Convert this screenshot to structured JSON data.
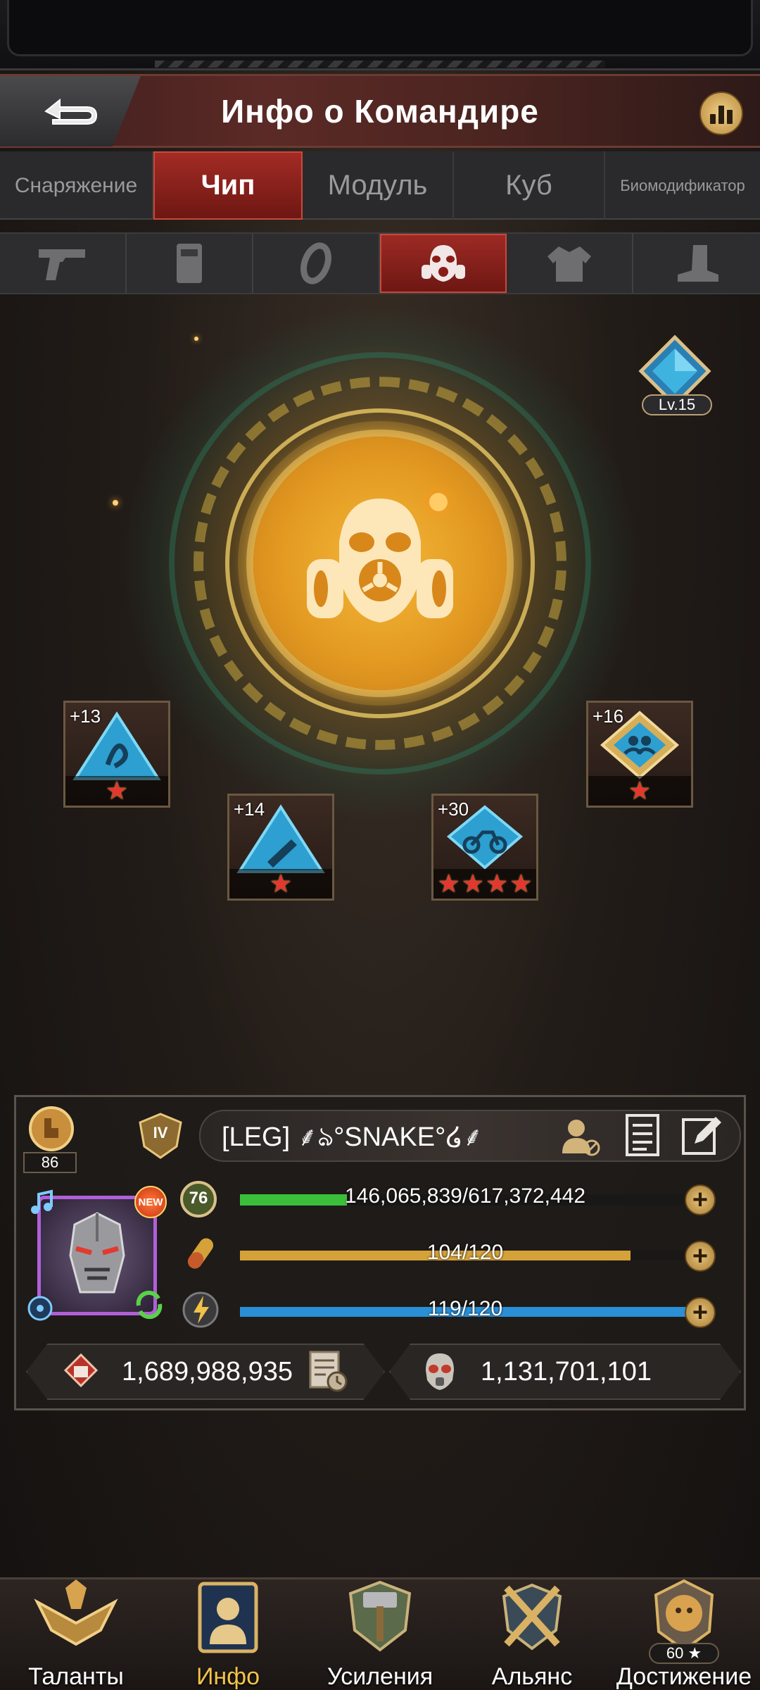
{
  "header": {
    "title": "Инфо о Командире"
  },
  "tabs": [
    {
      "label": "Снаряжение",
      "active": false
    },
    {
      "label": "Чип",
      "active": true
    },
    {
      "label": "Модуль",
      "active": false
    },
    {
      "label": "Куб",
      "active": false
    },
    {
      "label": "Биомодификатор",
      "active": false
    }
  ],
  "slots": [
    {
      "icon": "pistol-icon",
      "active": false
    },
    {
      "icon": "armor-plate-icon",
      "active": false
    },
    {
      "icon": "ring-icon",
      "active": false
    },
    {
      "icon": "gas-mask-icon",
      "active": true
    },
    {
      "icon": "jacket-icon",
      "active": false
    },
    {
      "icon": "boot-icon",
      "active": false
    }
  ],
  "chip_level": "Lv.15",
  "chips": [
    {
      "plus": "+13",
      "stars": 1,
      "icon": "triangle-chip-icon"
    },
    {
      "plus": "+14",
      "stars": 1,
      "icon": "triangle-chip-icon"
    },
    {
      "plus": "+30",
      "stars": 4,
      "icon": "motorbike-chip-icon"
    },
    {
      "plus": "+16",
      "stars": 1,
      "icon": "diamond-chip-icon"
    }
  ],
  "commander": {
    "rank_number": "86",
    "vip_level": "IV",
    "name": "[LEG] ⸙ঌ°SNAKE°໒⸙",
    "level": "76",
    "exp": "146,065,839/617,372,442",
    "exp_fraction": 0.237,
    "stamina": "104/120",
    "stamina_fraction": 0.867,
    "energy": "119/120",
    "energy_fraction": 0.992,
    "power": "1,689,988,935",
    "kills": "1,131,701,101",
    "avatar_badge": "NEW"
  },
  "colors": {
    "exp_bar": "#3bbf3b",
    "stamina_bar": "#d5a23a",
    "energy_bar": "#2a8fd6",
    "active_tab": "#a32b25",
    "nav_active": "#f3c24b"
  },
  "nav": [
    {
      "label": "Таланты",
      "icon": "eagle-emblem-icon"
    },
    {
      "label": "Инфо",
      "icon": "commander-info-icon",
      "active": true
    },
    {
      "label": "Усиления",
      "icon": "hammer-shield-icon"
    },
    {
      "label": "Альянс",
      "icon": "crossed-swords-icon"
    },
    {
      "label": "Достижение",
      "icon": "lion-crest-icon",
      "badge": "60 ★"
    }
  ]
}
